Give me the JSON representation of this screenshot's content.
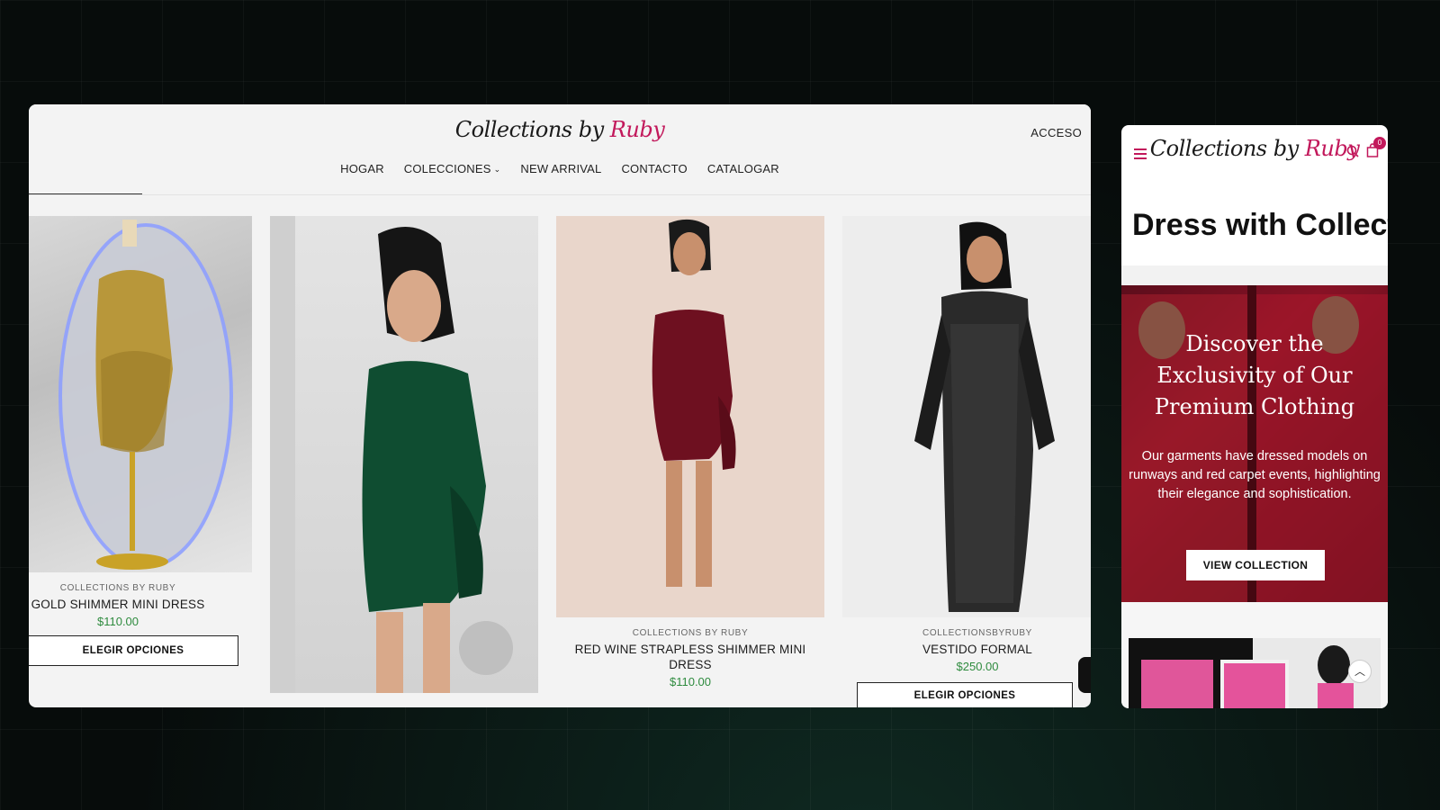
{
  "brand": {
    "logo_part1": "Collections by",
    "logo_part2": "Ruby",
    "accent": "#c2185b",
    "price_color": "#2e8b3e"
  },
  "desktop": {
    "login_label": "ACCESO",
    "nav": {
      "home": "HOGAR",
      "collections": "COLECCIONES",
      "new_arrival": "NEW ARRIVAL",
      "contact": "CONTACTO",
      "catalog": "CATALOGAR"
    },
    "products": [
      {
        "vendor": "COLLECTIONS BY RUBY",
        "name": "GOLD SHIMMER MINI DRESS",
        "price": "$110.00",
        "button": "ELEGIR OPCIONES",
        "icon": "gold-dress-image"
      },
      {
        "icon": "green-dress-image"
      },
      {
        "vendor": "COLLECTIONS BY RUBY",
        "name": "RED WINE STRAPLESS SHIMMER MINI DRESS",
        "price": "$110.00",
        "icon": "red-dress-image"
      },
      {
        "vendor": "COLLECTIONSBYRUBY",
        "name": "VESTIDO FORMAL",
        "price": "$250.00",
        "button": "ELEGIR OPCIONES",
        "icon": "black-gown-image"
      }
    ]
  },
  "mobile": {
    "headline": "Dress with Collect",
    "hero": {
      "title": "Discover the Exclusivity of Our Premium Clothing",
      "text": "Our garments have dressed models on runways and red carpet events, highlighting their elegance and sophistication.",
      "button": "VIEW COLLECTION"
    },
    "cart_count": "0"
  }
}
